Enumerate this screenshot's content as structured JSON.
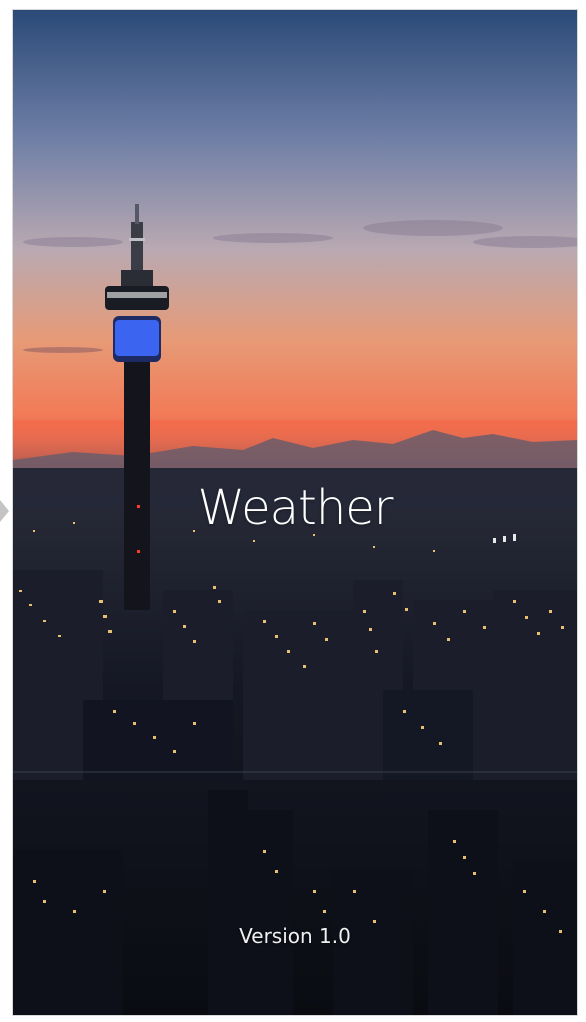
{
  "splash": {
    "title": "Weather",
    "version": "Version 1.0"
  },
  "background": {
    "description_icon": "city-skyline-sunset-image"
  },
  "colors": {
    "sky_top": "#2b4a78",
    "sky_mid": "#a9a8c0",
    "sky_horizon": "#f27a57",
    "city_dark": "#0d1018",
    "light_warm": "#ffd27a",
    "tower_lights": "#3f6cff",
    "text": "#ffffff"
  }
}
